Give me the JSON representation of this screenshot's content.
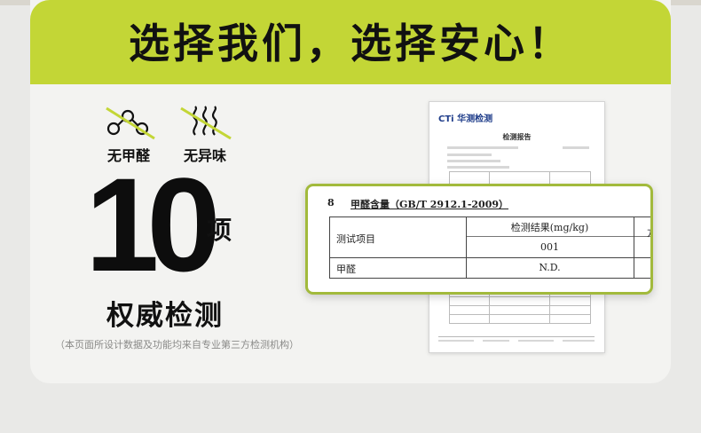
{
  "headline": "选择我们，选择安心！",
  "features": [
    {
      "label": "无甲醛",
      "icon": "formaldehyde-molecule-crossed-icon"
    },
    {
      "label": "无异味",
      "icon": "odor-waves-crossed-icon"
    }
  ],
  "count": "10",
  "count_unit": "项",
  "subtitle": "权威检测",
  "disclaimer": "（本页面所设计数据及功能均来自专业第三方检测机构）",
  "report": {
    "logo": "CTi 华测检测",
    "title": "检测报告"
  },
  "overlay": {
    "section_no": "8",
    "section_title": "甲醛含量（GB/T 2912.1-2009）",
    "col_item_header": "测试项目",
    "col_result_header": "检测结果(mg/kg)",
    "sample_no": "001",
    "cut_off_header": "方",
    "row_item": "甲醛",
    "row_value": "N.D."
  },
  "colors": {
    "accent": "#c3d636",
    "popup_border": "#a2ba3c",
    "card_bg": "#f3f3f1",
    "page_bg": "#e9e9e7",
    "logo_blue": "#1f3d8a"
  }
}
